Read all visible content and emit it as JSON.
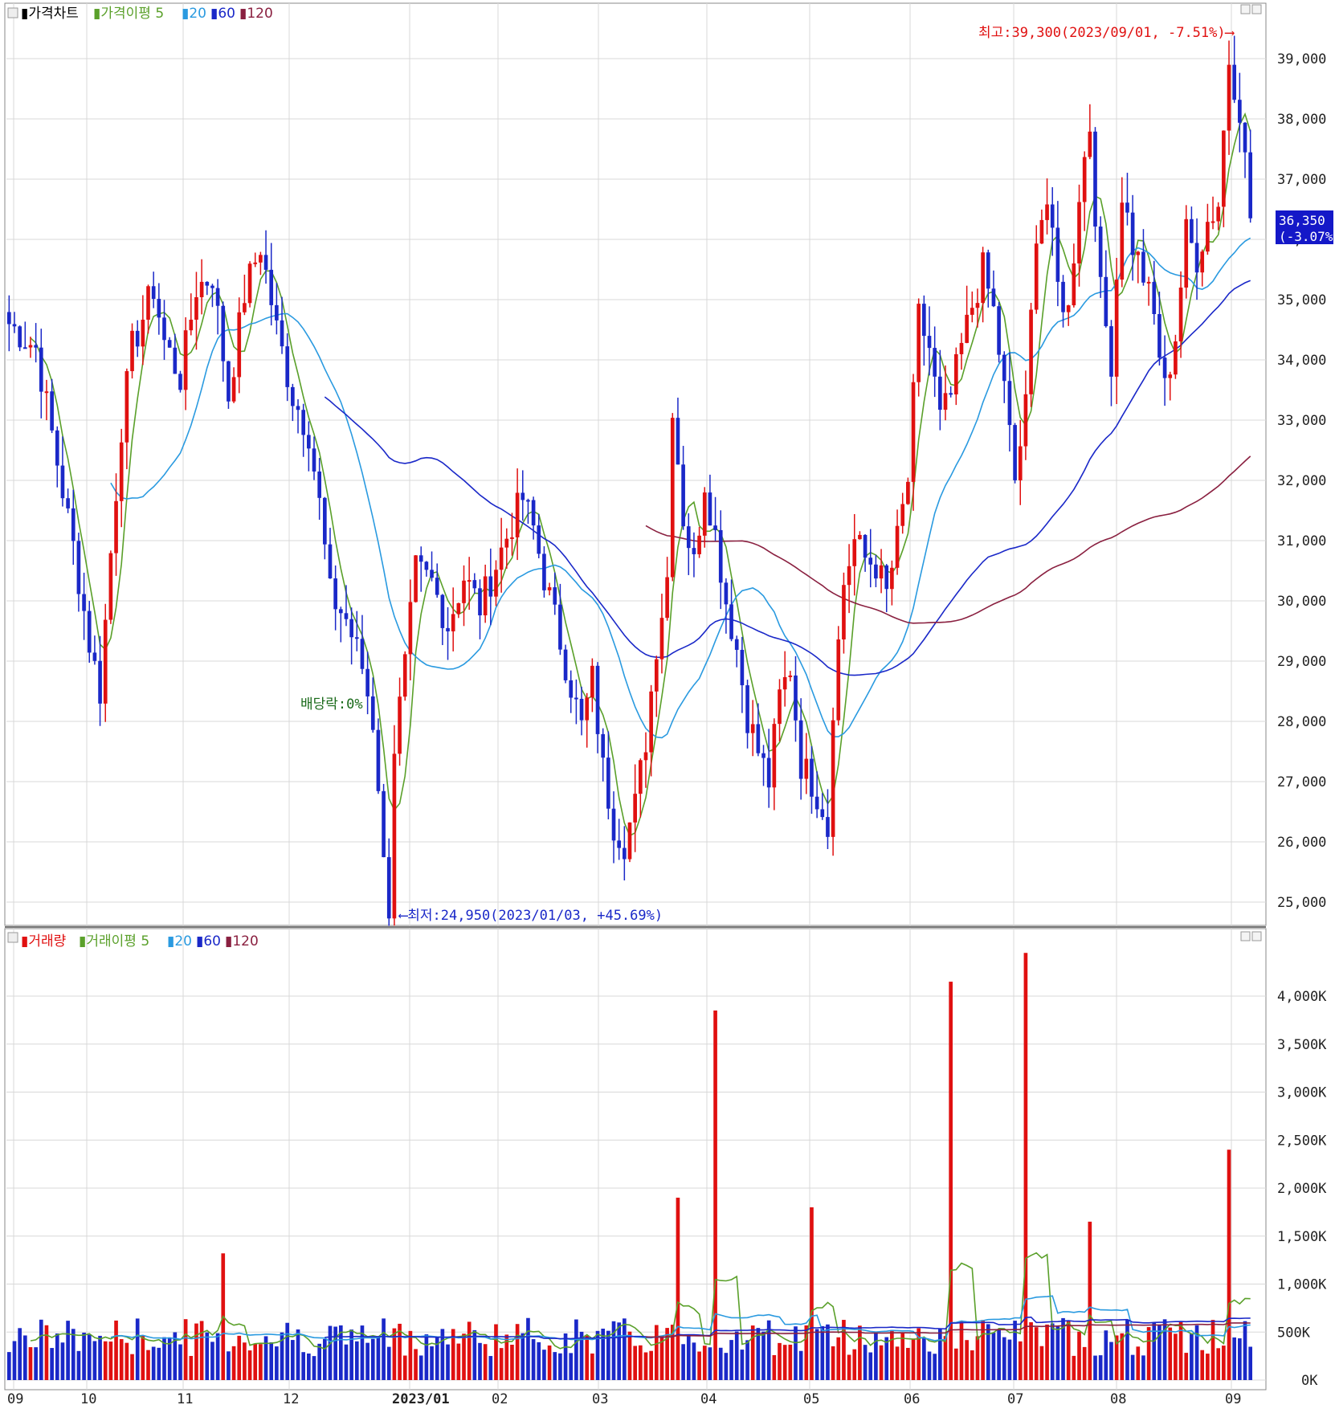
{
  "colors": {
    "up": "#e01010",
    "down": "#1a28c8",
    "ma5": "#5aa02a",
    "ma20": "#2a9ae0",
    "ma60": "#1a28c8",
    "ma120": "#8a2040",
    "grid": "#d8d8d8",
    "highlight_bg": "#1418c8"
  },
  "price_panel": {
    "legend": {
      "price_chart": "가격차트",
      "ma_label": "가격이평",
      "ma5": "5",
      "ma20": "20",
      "ma60": "60",
      "ma120": "120"
    },
    "high_annotation": "최고:39,300(2023/09/01, -7.51%)",
    "low_annotation": "최저:24,950(2023/01/03, +45.69%)",
    "dividend_annotation": "배당락:0%",
    "current_price": "36,350",
    "current_change": "(-3.07%)"
  },
  "volume_panel": {
    "legend": {
      "volume": "거래량",
      "ma_label": "거래이평",
      "ma5": "5",
      "ma20": "20",
      "ma60": "60",
      "ma120": "120"
    }
  },
  "x_axis_labels": [
    "09",
    "10",
    "11",
    "12",
    "2023/01",
    "02",
    "03",
    "04",
    "05",
    "06",
    "07",
    "08",
    "09"
  ],
  "chart_data": [
    {
      "type": "candlestick",
      "y_ticks": [
        "39,000",
        "38,000",
        "37,000",
        "36,000",
        "35,000",
        "34,000",
        "33,000",
        "32,000",
        "31,000",
        "30,000",
        "29,000",
        "28,000",
        "27,000",
        "26,000",
        "25,000"
      ],
      "ylim": [
        24700,
        39800
      ],
      "series": [
        {
          "name": "가격차트",
          "ohlc_close_points": [
            [
              0,
              34600
            ],
            [
              5,
              34200
            ],
            [
              9,
              32300
            ],
            [
              12,
              30900
            ],
            [
              15,
              29300
            ],
            [
              17,
              28500
            ],
            [
              19,
              30800
            ],
            [
              21,
              32900
            ],
            [
              23,
              34200
            ],
            [
              27,
              35200
            ],
            [
              29,
              34300
            ],
            [
              32,
              33700
            ],
            [
              35,
              35200
            ],
            [
              38,
              35400
            ],
            [
              41,
              33400
            ],
            [
              44,
              35100
            ],
            [
              47,
              35900
            ],
            [
              50,
              34500
            ],
            [
              53,
              33400
            ],
            [
              56,
              32800
            ],
            [
              58,
              31600
            ],
            [
              60,
              30100
            ],
            [
              63,
              29700
            ],
            [
              66,
              28900
            ],
            [
              68,
              28000
            ],
            [
              69,
              27000
            ],
            [
              70,
              25600
            ],
            [
              71,
              24950
            ],
            [
              72,
              27600
            ],
            [
              74,
              28900
            ],
            [
              76,
              30500
            ],
            [
              79,
              30300
            ],
            [
              82,
              29600
            ],
            [
              85,
              30400
            ],
            [
              88,
              29900
            ],
            [
              91,
              30600
            ],
            [
              94,
              31300
            ],
            [
              96,
              31700
            ],
            [
              98,
              31200
            ],
            [
              100,
              30400
            ],
            [
              102,
              29700
            ],
            [
              105,
              28600
            ],
            [
              107,
              27900
            ],
            [
              109,
              28700
            ],
            [
              111,
              27200
            ],
            [
              113,
              26300
            ],
            [
              115,
              26000
            ],
            [
              117,
              26600
            ],
            [
              119,
              27700
            ],
            [
              121,
              29300
            ],
            [
              123,
              30400
            ],
            [
              124,
              33300
            ],
            [
              126,
              31400
            ],
            [
              128,
              30600
            ],
            [
              130,
              32000
            ],
            [
              132,
              31100
            ],
            [
              134,
              30000
            ],
            [
              136,
              29200
            ],
            [
              138,
              28100
            ],
            [
              140,
              27500
            ],
            [
              142,
              27000
            ],
            [
              144,
              28400
            ],
            [
              146,
              28900
            ],
            [
              148,
              27300
            ],
            [
              150,
              27000
            ],
            [
              152,
              26600
            ],
            [
              153,
              26200
            ],
            [
              154,
              28300
            ],
            [
              156,
              30300
            ],
            [
              158,
              31000
            ],
            [
              160,
              30700
            ],
            [
              162,
              30600
            ],
            [
              164,
              30100
            ],
            [
              166,
              31000
            ],
            [
              168,
              32000
            ],
            [
              170,
              34700
            ],
            [
              172,
              34200
            ],
            [
              174,
              33000
            ],
            [
              176,
              33400
            ],
            [
              178,
              34200
            ],
            [
              180,
              34900
            ],
            [
              182,
              35500
            ],
            [
              184,
              34800
            ],
            [
              186,
              33500
            ],
            [
              188,
              32000
            ],
            [
              190,
              33200
            ],
            [
              192,
              36200
            ],
            [
              194,
              36600
            ],
            [
              196,
              35200
            ],
            [
              198,
              34800
            ],
            [
              200,
              36800
            ],
            [
              202,
              37900
            ],
            [
              204,
              35100
            ],
            [
              206,
              34000
            ],
            [
              208,
              36800
            ],
            [
              210,
              35900
            ],
            [
              212,
              35400
            ],
            [
              214,
              34700
            ],
            [
              216,
              33500
            ],
            [
              218,
              34400
            ],
            [
              220,
              36100
            ],
            [
              222,
              35700
            ],
            [
              224,
              36300
            ],
            [
              226,
              36600
            ],
            [
              228,
              39000
            ],
            [
              230,
              38200
            ],
            [
              231,
              37300
            ],
            [
              232,
              36350
            ]
          ]
        }
      ]
    },
    {
      "type": "bar",
      "title": "거래량",
      "y_ticks": [
        "4,000K",
        "3,500K",
        "3,000K",
        "2,500K",
        "2,000K",
        "1,500K",
        "1,000K",
        "500K",
        "0K"
      ],
      "ylim": [
        0,
        4600
      ],
      "series": [
        {
          "name": "거래량",
          "notable_values_k": [
            {
              "x": "2023/03",
              "value": 1900
            },
            {
              "x": "2023/04",
              "value": 3850
            },
            {
              "x": "2023/05",
              "value": 1800
            },
            {
              "x": "2023/06",
              "value": 4150
            },
            {
              "x": "2023/07",
              "value": 4450
            },
            {
              "x": "2023/08",
              "value": 1650
            },
            {
              "x": "2023/09",
              "value": 2400
            },
            {
              "x": "2022/11",
              "value": 1320
            }
          ]
        }
      ]
    }
  ]
}
